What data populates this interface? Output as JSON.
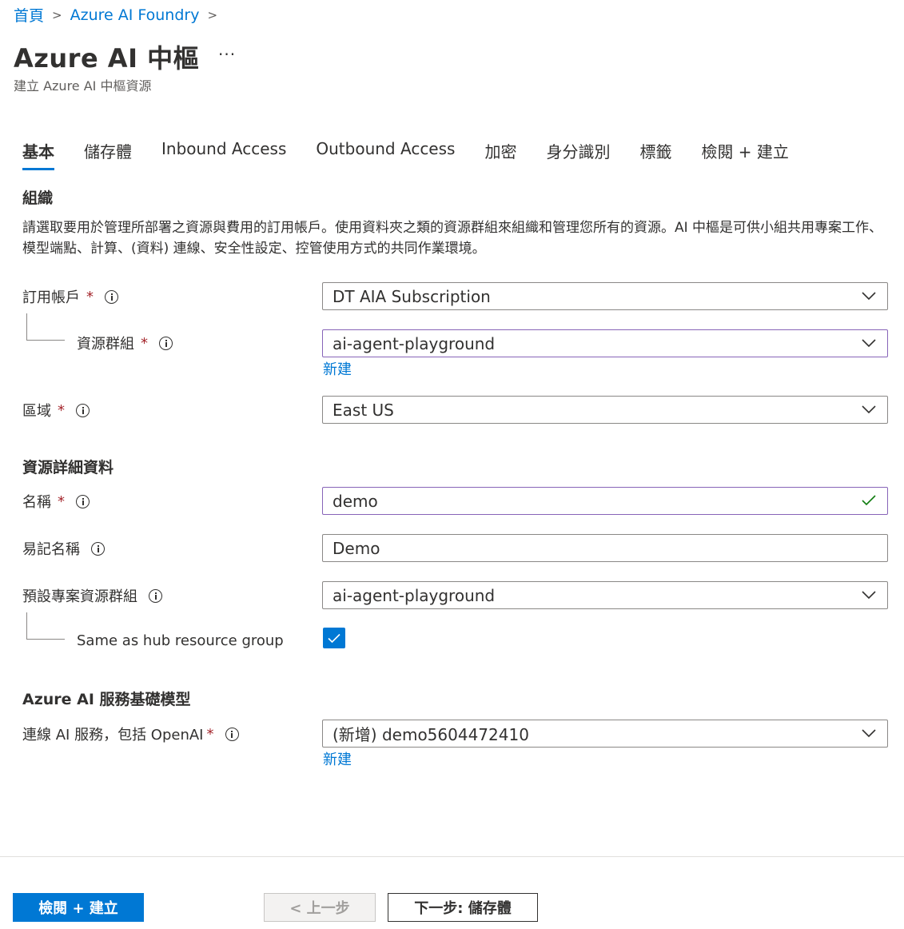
{
  "breadcrumb": {
    "home": "首頁",
    "foundry": "Azure AI Foundry"
  },
  "header": {
    "title": "Azure AI 中樞",
    "more": "···",
    "subtitle": "建立 Azure AI 中樞資源"
  },
  "tabs": [
    {
      "label": "基本",
      "active": true
    },
    {
      "label": "儲存體"
    },
    {
      "label": "Inbound Access"
    },
    {
      "label": "Outbound Access"
    },
    {
      "label": "加密"
    },
    {
      "label": "身分識別"
    },
    {
      "label": "標籤"
    },
    {
      "label": "檢閱 + 建立"
    }
  ],
  "org": {
    "title": "組織",
    "description": "請選取要用於管理所部署之資源與費用的訂用帳戶。使用資料夾之類的資源群組來組織和管理您所有的資源。AI 中樞是可供小組共用專案工作、模型端點、計算、(資料) 連線、安全性設定、控管使用方式的共同作業環境。",
    "subscription": {
      "label": "訂用帳戶",
      "value": "DT AIA Subscription"
    },
    "resource_group": {
      "label": "資源群組",
      "value": "ai-agent-playground",
      "new_link": "新建"
    },
    "region": {
      "label": "區域",
      "value": "East US"
    }
  },
  "details": {
    "title": "資源詳細資料",
    "name": {
      "label": "名稱",
      "value": "demo"
    },
    "friendly_name": {
      "label": "易記名稱",
      "value": "Demo"
    },
    "default_project_rg": {
      "label": "預設專案資源群組",
      "value": "ai-agent-playground"
    },
    "same_as_hub": {
      "label": "Same as hub resource group",
      "checked": true
    }
  },
  "ai_services": {
    "title": "Azure AI 服務基礎模型",
    "connect": {
      "label": "連線 AI 服務，包括 OpenAI",
      "value": "(新增) demo5604472410",
      "new_link": "新建"
    }
  },
  "required_mark": "*",
  "footer": {
    "review_create": "檢閱 + 建立",
    "previous": "< 上一步",
    "next": "下一步: 儲存體"
  },
  "colors": {
    "accent": "#0078d4",
    "required": "#a4262c",
    "focus": "#8764b8",
    "valid": "#107c10"
  }
}
